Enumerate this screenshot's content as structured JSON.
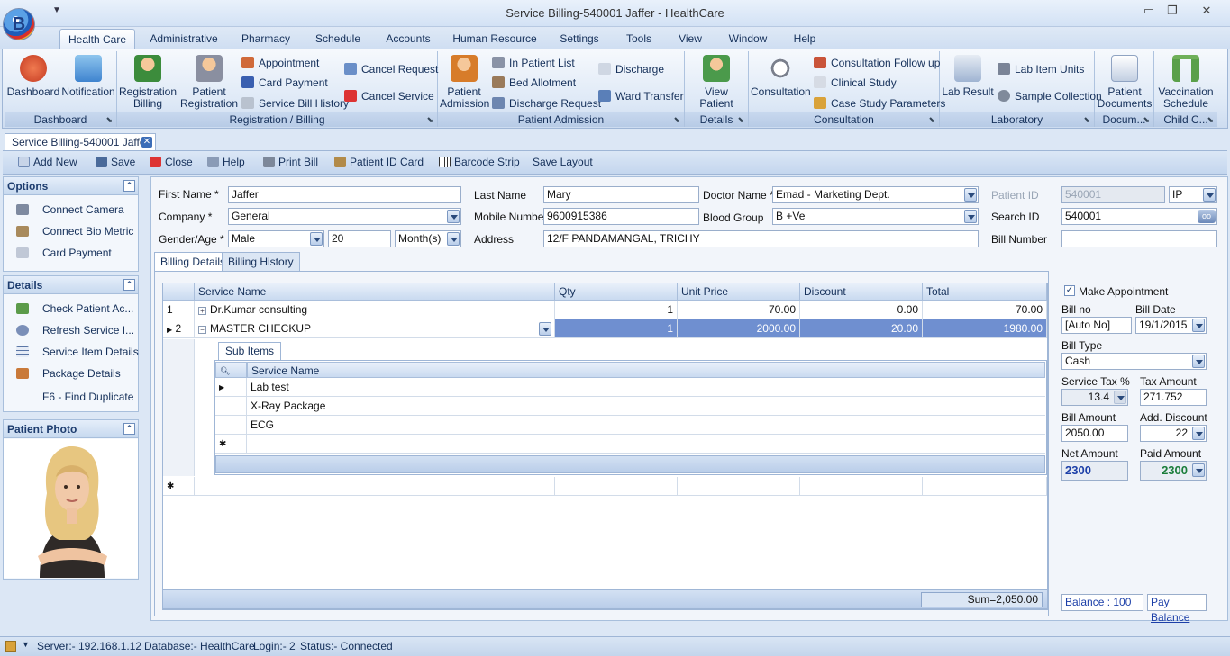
{
  "window": {
    "title": "Service Billing-540001 Jaffer - HealthCare",
    "logo_letter": "B"
  },
  "menu": [
    "Health Care",
    "Administrative",
    "Pharmacy",
    "Schedule",
    "Accounts",
    "Human Resource",
    "Settings",
    "Tools",
    "View",
    "Window",
    "Help"
  ],
  "ribbon": {
    "groups": [
      "Dashboard",
      "Registration / Billing",
      "Patient Admission",
      "Details",
      "Consultation",
      "Laboratory",
      "Docum...",
      "Child C..."
    ],
    "dashboard": [
      "Dashboard",
      "Notification"
    ],
    "reg_big": [
      "Registration Billing",
      "Patient Registration"
    ],
    "reg_small": [
      "Appointment",
      "Card Payment",
      "Service Bill History",
      "Cancel Request",
      "Cancel Service"
    ],
    "adm_big": "Patient Admission",
    "adm_small": [
      "In Patient List",
      "Bed Allotment",
      "Discharge Request",
      "Discharge",
      "Ward Transfer"
    ],
    "details": "View Patient",
    "consult_big": "Consultation",
    "consult_small": [
      "Consultation Follow up",
      "Clinical Study",
      "Case Study Parameters"
    ],
    "lab_big": "Lab Result",
    "lab_small": [
      "Lab Item Units",
      "Sample Collection"
    ],
    "docs": "Patient Documents",
    "child": "Vaccination Schedule"
  },
  "doc_tab": "Service Billing-540001 Jaffer",
  "toolbar": [
    "Add New",
    "Save",
    "Close",
    "Help",
    "Print Bill",
    "Patient ID Card",
    "Barcode Strip",
    "Save Layout"
  ],
  "options": {
    "title": "Options",
    "items": [
      "Connect Camera",
      "Connect Bio Metric",
      "Card Payment"
    ]
  },
  "details": {
    "title": "Details",
    "items": [
      "Check Patient Ac...",
      "Refresh Service I...",
      "Service Item Details",
      "Package Details"
    ],
    "shortcut": "F6 - Find Duplicate"
  },
  "photo": {
    "title": "Patient Photo"
  },
  "form": {
    "first_name_label": "First Name *",
    "first_name": "Jaffer",
    "last_name_label": "Last Name",
    "last_name": "Mary",
    "doctor_label": "Doctor Name *",
    "doctor": "Emad - Marketing Dept.",
    "patient_id_label": "Patient ID",
    "patient_id": "540001",
    "patient_type": "IP",
    "company_label": "Company *",
    "company": "General",
    "mobile_label": "Mobile Number",
    "mobile": "9600915386",
    "blood_label": "Blood Group",
    "blood": "B +Ve",
    "search_label": "Search ID",
    "search": "540001",
    "gender_label": "Gender/Age *",
    "gender": "Male",
    "age": "20",
    "age_unit": "Month(s)",
    "address_label": "Address",
    "address": "12/F PANDAMANGAL, TRICHY",
    "bill_number_label": "Bill Number",
    "bill_number": ""
  },
  "tabs": [
    "Billing Details",
    "Billing History"
  ],
  "grid": {
    "headers": [
      "Service Name",
      "Qty",
      "Unit Price",
      "Discount",
      "Total"
    ],
    "rows": [
      {
        "no": "1",
        "name": "Dr.Kumar consulting",
        "qty": "1",
        "price": "70.00",
        "discount": "0.00",
        "total": "70.00"
      },
      {
        "no": "2",
        "name": "MASTER CHECKUP",
        "qty": "1",
        "price": "2000.00",
        "discount": "20.00",
        "total": "1980.00"
      }
    ],
    "sub_tab": "Sub Items",
    "sub_header": "Service Name",
    "sub_items": [
      "Lab test",
      "X-Ray Package",
      "ECG"
    ],
    "sum": "Sum=2,050.00"
  },
  "billing": {
    "make_appt": "Make Appointment",
    "bill_no_label": "Bill no",
    "bill_no": "[Auto No]",
    "bill_date_label": "Bill Date",
    "bill_date": "19/1/2015",
    "bill_type_label": "Bill Type",
    "bill_type": "Cash",
    "tax_pct_label": "Service Tax %",
    "tax_pct": "13.4",
    "tax_amt_label": "Tax Amount",
    "tax_amt": "271.752",
    "bill_amt_label": "Bill Amount",
    "bill_amt": "2050.00",
    "add_disc_label": "Add. Discount",
    "add_disc": "22",
    "net_label": "Net Amount",
    "net": "2300",
    "paid_label": "Paid Amount",
    "paid": "2300",
    "balance": "Balance : 100",
    "pay_balance": "Pay Balance"
  },
  "status": {
    "server": "Server:- 192.168.1.12",
    "database": "Database:- HealthCare",
    "login": "Login:- 2",
    "conn": "Status:- Connected"
  },
  "colors": {
    "accent": "#6f8fd0",
    "net_amount": "#1c3fa8",
    "paid_amount": "#1a7d3a"
  }
}
